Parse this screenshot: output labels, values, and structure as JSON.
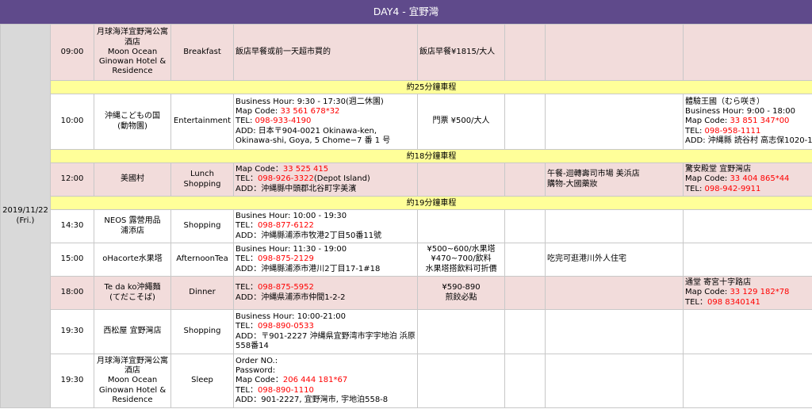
{
  "header": {
    "title": "DAY4 - 宜野灣"
  },
  "date": {
    "line1": "2019/11/22",
    "line2": "(Fri.)"
  },
  "rows": [
    {
      "time": "09:00",
      "place": [
        "月球海洋宜野灣公寓",
        "酒店",
        "Moon Ocean",
        "Ginowan Hotel &",
        "Residence"
      ],
      "activity": "Breakfast",
      "info": "飯店早餐或前一天超市買的",
      "cost": "飯店早餐¥1815/大人"
    },
    {
      "transit": "約25分鐘車程"
    },
    {
      "time": "10:00",
      "place": [
        "沖縄こどもの国",
        "(動物園)"
      ],
      "activity": "Entertainment",
      "info1": "Business Hour: 9:30 - 17:30(週二休園)",
      "info2_label": "Map Code: ",
      "info2_value": "33 561 678*32",
      "info3_label": "TEL: ",
      "info3_value": "098-933-4190",
      "info4": "ADD: 日本〒904-0021 Okinawa-ken, Okinawa-shi, Goya, 5 Chome−7 番 1 号",
      "cost": "門票 ¥500/大人",
      "extra1": "體驗王國（むら咲き）",
      "extra2": "Business Hour: 9:00 - 18:00",
      "extra3_label": "Map Code: ",
      "extra3_value": "33 851 347*00",
      "extra4_label": "TEL: ",
      "extra4_value": "098-958-1111",
      "extra5": "ADD: 沖縄縣 読谷村 高志保1020-1"
    },
    {
      "transit": "約18分鐘車程"
    },
    {
      "time": "12:00",
      "place": [
        "美國村"
      ],
      "activity": [
        "Lunch",
        "Shopping"
      ],
      "info1_label": "Map Code：",
      "info1_value": "33 525 415",
      "info2_label": "TEL：",
      "info2_value": "098-926-3322",
      "info2_suffix": "(Depot Island)",
      "info3": "ADD：沖縄縣中頭郡北谷町字美濱",
      "note1": "午餐-迴轉壽司市場 美浜店",
      "note2": "購物-大國藥妝",
      "extra1": "驚安殿堂 宜野灣店",
      "extra2_label": "Map Code: ",
      "extra2_value": "33 404 865*44",
      "extra3_label": "TEL: ",
      "extra3_value": "098-942-9911"
    },
    {
      "transit": "約19分鐘車程"
    },
    {
      "time": "14:30",
      "place": [
        "NEOS 露營用品",
        "浦添店"
      ],
      "activity": "Shopping",
      "info1": "Busines Hour: 10:00 - 19:30",
      "info2_label": "TEL：",
      "info2_value": "098-877-6122",
      "info3": "ADD：沖縄縣浦添市牧港2丁目50番11號"
    },
    {
      "time": "15:00",
      "place": [
        "oHacorte水果塔"
      ],
      "activity": "AfternoonTea",
      "info1": "Busines Hour: 11:30 - 19:00",
      "info2_label": "TEL：",
      "info2_value": "098-875-2129",
      "info3": "ADD：沖縄縣浦添市港川2丁目17-1#18",
      "cost": [
        "¥500~600/水果塔",
        "¥470~700/飲料",
        "水果塔搭飲料可折價"
      ],
      "note1": "吃完可逛港川外人住宅"
    },
    {
      "time": "18:00",
      "place": [
        "Te da ko沖繩麵",
        "(てだこそば)"
      ],
      "activity": "Dinner",
      "info1_label": "TEL：",
      "info1_value": "098-875-5952",
      "info2": "ADD：沖縄県浦添市仲間1-2-2",
      "cost": [
        "¥590-890",
        "煎餃必點"
      ],
      "extra1": "通堂 寄宮十字路店",
      "extra2_label": "Map Code: ",
      "extra2_value": "33 129 182*78",
      "extra3_label": "TEL：",
      "extra3_value": "098 8340141"
    },
    {
      "time": "19:30",
      "place": [
        "西松屋 宜野灣店"
      ],
      "activity": "Shopping",
      "info1": "Business Hour: 10:00-21:00",
      "info2_label": "TEL：",
      "info2_value": "098-890-0533",
      "info3": "ADD：〒901-2227 沖縄県宜野湾市字宇地泊 浜原558番14"
    },
    {
      "time": "19:30",
      "place": [
        "月球海洋宜野灣公寓",
        "酒店",
        "Moon Ocean",
        "Ginowan Hotel &",
        "Residence"
      ],
      "activity": "Sleep",
      "info1": "Order NO.:",
      "info2": "Password:",
      "info3_label": "Map Code：",
      "info3_value": "206 444 181*67",
      "info4_label": "TEL：",
      "info4_value": "098-890-1110",
      "info5": "ADD：901-2227, 宜野灣市, 宇地泊558-8"
    }
  ],
  "colors": {
    "header": "#5f4a8b",
    "pink": "#f2dcdb",
    "transit": "#ffff99",
    "red": "#ff0000",
    "date": "#d9d9d9"
  }
}
